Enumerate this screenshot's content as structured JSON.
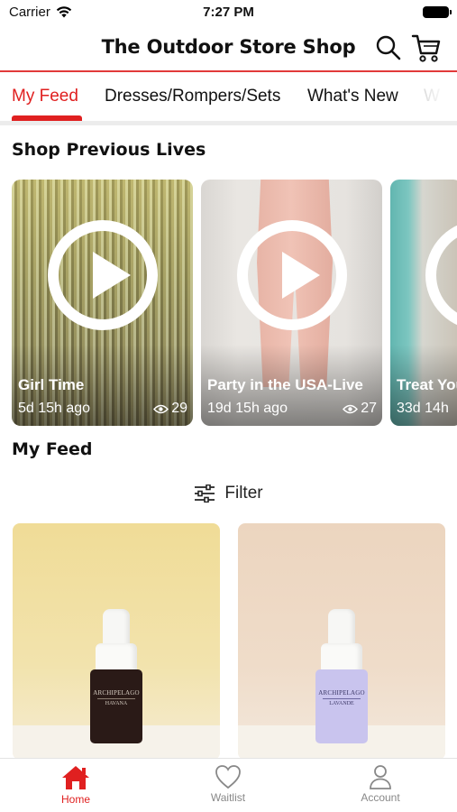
{
  "status_bar": {
    "carrier": "Carrier",
    "time": "7:27 PM"
  },
  "header": {
    "title": "The Outdoor Store Shop",
    "icons": [
      "search-icon",
      "cart-icon"
    ]
  },
  "tabs": [
    {
      "label": "My Feed",
      "active": true
    },
    {
      "label": "Dresses/Rompers/Sets",
      "active": false
    },
    {
      "label": "What's New",
      "active": false
    },
    {
      "label": "W",
      "active": false
    }
  ],
  "previous_lives": {
    "title": "Shop Previous Lives",
    "items": [
      {
        "name": "Girl Time",
        "ago": "5d 15h ago",
        "views": "29"
      },
      {
        "name": "Party in the USA-Live",
        "ago": "19d 15h ago",
        "views": "27"
      },
      {
        "name": "Treat You",
        "ago": "33d 14h",
        "views": ""
      }
    ]
  },
  "feed": {
    "title": "My Feed",
    "filter_label": "Filter",
    "products": [
      {
        "brand": "ARCHIPELAGO",
        "scent": "HAVANA",
        "bottle_color": "#2a1a17"
      },
      {
        "brand": "ARCHIPELAGO",
        "scent": "LAVANDE",
        "bottle_color": "#c9c4ee"
      }
    ]
  },
  "bottom_nav": {
    "items": [
      {
        "label": "Home",
        "icon": "home-icon",
        "active": true
      },
      {
        "label": "Waitlist",
        "icon": "heart-icon",
        "active": false
      },
      {
        "label": "Account",
        "icon": "person-icon",
        "active": false
      }
    ]
  },
  "colors": {
    "accent": "#e02020",
    "header_rule": "#e23a3a"
  }
}
